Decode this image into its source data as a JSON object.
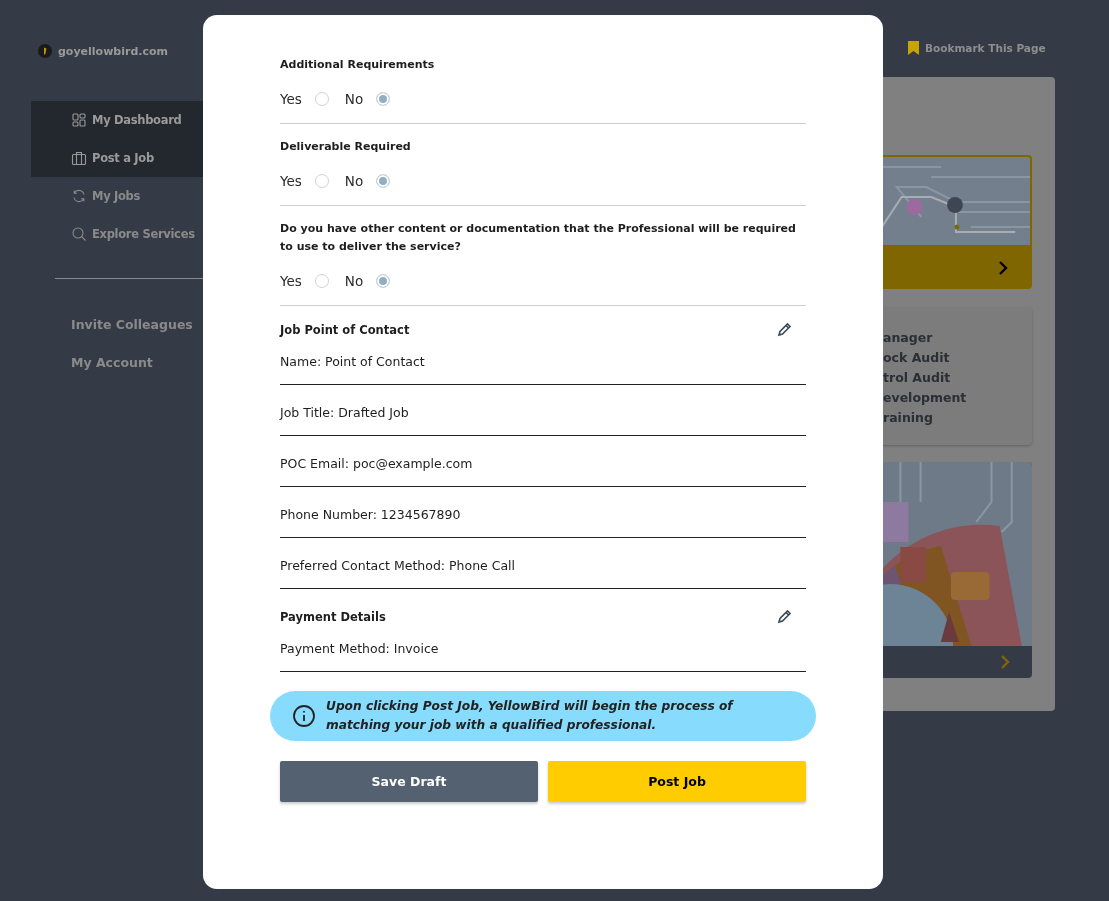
{
  "site": {
    "name": "goyellowbird.com"
  },
  "bookmark": {
    "label": "Bookmark This Page"
  },
  "sidebar": {
    "items": [
      {
        "label": "My Dashboard",
        "selected": true
      },
      {
        "label": "Post a Job",
        "selected": true
      },
      {
        "label": "My Jobs",
        "selected": false
      },
      {
        "label": "Explore Services",
        "selected": false
      }
    ],
    "secondary_items": [
      {
        "label": "Invite Colleagues"
      },
      {
        "label": "My Account"
      }
    ]
  },
  "background_cards": {
    "list_lines": [
      "anager",
      "ock Audit",
      "trol Audit",
      "evelopment",
      "raining"
    ]
  },
  "modal": {
    "questions": [
      {
        "title": "Additional Requirements",
        "options": [
          {
            "label": "Yes",
            "selected": false
          },
          {
            "label": "No",
            "selected": true
          }
        ]
      },
      {
        "title": "Deliverable Required",
        "options": [
          {
            "label": "Yes",
            "selected": false
          },
          {
            "label": "No",
            "selected": true
          }
        ]
      },
      {
        "title": "Do you have other content or documentation that the Professional will be required to use to deliver the service?",
        "options": [
          {
            "label": "Yes",
            "selected": false
          },
          {
            "label": "No",
            "selected": true
          }
        ]
      }
    ],
    "sections": [
      {
        "title": "Job Point of Contact",
        "fields": [
          "Name: Point of Contact",
          "Job Title: Drafted Job",
          "POC Email: poc@example.com",
          "Phone Number: 1234567890",
          "Preferred Contact Method: Phone Call"
        ]
      },
      {
        "title": "Payment Details",
        "fields": [
          "Payment Method: Invoice"
        ]
      }
    ],
    "notice": "Upon clicking Post Job, YellowBird will begin the process of matching your job with a qualified professional.",
    "buttons": [
      {
        "label": "Save Draft",
        "kind": "secondary"
      },
      {
        "label": "Post Job",
        "kind": "primary"
      }
    ]
  }
}
